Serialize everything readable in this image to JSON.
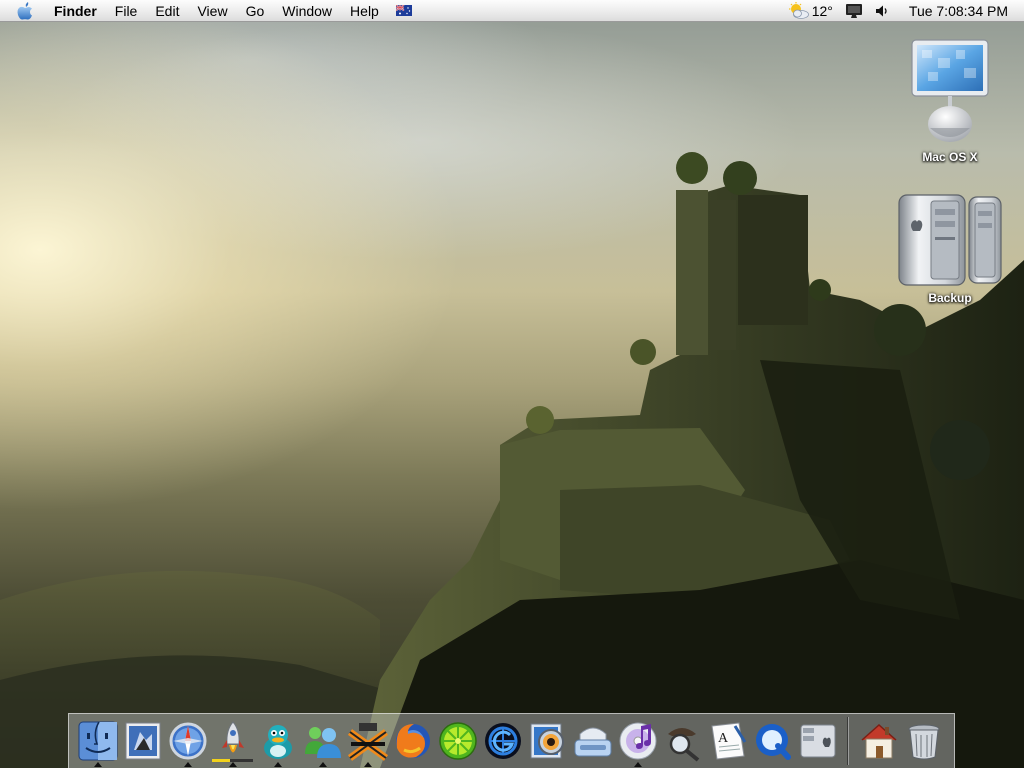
{
  "menubar": {
    "app_name": "Finder",
    "menus": [
      "File",
      "Edit",
      "View",
      "Go",
      "Window",
      "Help"
    ],
    "input_source_icon": "australian-flag-icon",
    "weather": {
      "temperature": "12°",
      "icon": "partly-cloudy-icon"
    },
    "display_icon": "display-icon",
    "volume_icon": "speaker-icon",
    "clock": "Tue 7:08:34 PM"
  },
  "desktop": {
    "icons": [
      {
        "label": "Mac OS X",
        "icon": "imac-icon"
      },
      {
        "label": "Backup",
        "icon": "power-mac-icon"
      }
    ]
  },
  "dock": {
    "apps": [
      {
        "icon": "finder-icon",
        "running": true
      },
      {
        "icon": "mail-icon",
        "running": false
      },
      {
        "icon": "safari-compass-icon",
        "running": true
      },
      {
        "icon": "rocket-icon",
        "running": true,
        "progress": 0.45
      },
      {
        "icon": "adium-duck-icon",
        "running": true
      },
      {
        "icon": "messenger-buddies-icon",
        "running": true
      },
      {
        "icon": "x-tool-icon",
        "running": true
      },
      {
        "icon": "firefox-icon",
        "running": false
      },
      {
        "icon": "limewire-icon",
        "running": false
      },
      {
        "icon": "g-target-icon",
        "running": false
      },
      {
        "icon": "preview-eye-icon",
        "running": false
      },
      {
        "icon": "tape-drive-icon",
        "running": false
      },
      {
        "icon": "itunes-icon",
        "running": true
      },
      {
        "icon": "sherlock-icon",
        "running": false
      },
      {
        "icon": "textedit-icon",
        "running": false
      },
      {
        "icon": "quicktime-icon",
        "running": false
      },
      {
        "icon": "system-preferences-icon",
        "running": false
      }
    ],
    "right": [
      {
        "icon": "home-folder-icon"
      },
      {
        "icon": "trash-icon"
      }
    ]
  },
  "colors": {
    "menubar_top": "#fdfdfd",
    "dock_indicator": "#111111",
    "progress_fill": "#f2d21b"
  }
}
